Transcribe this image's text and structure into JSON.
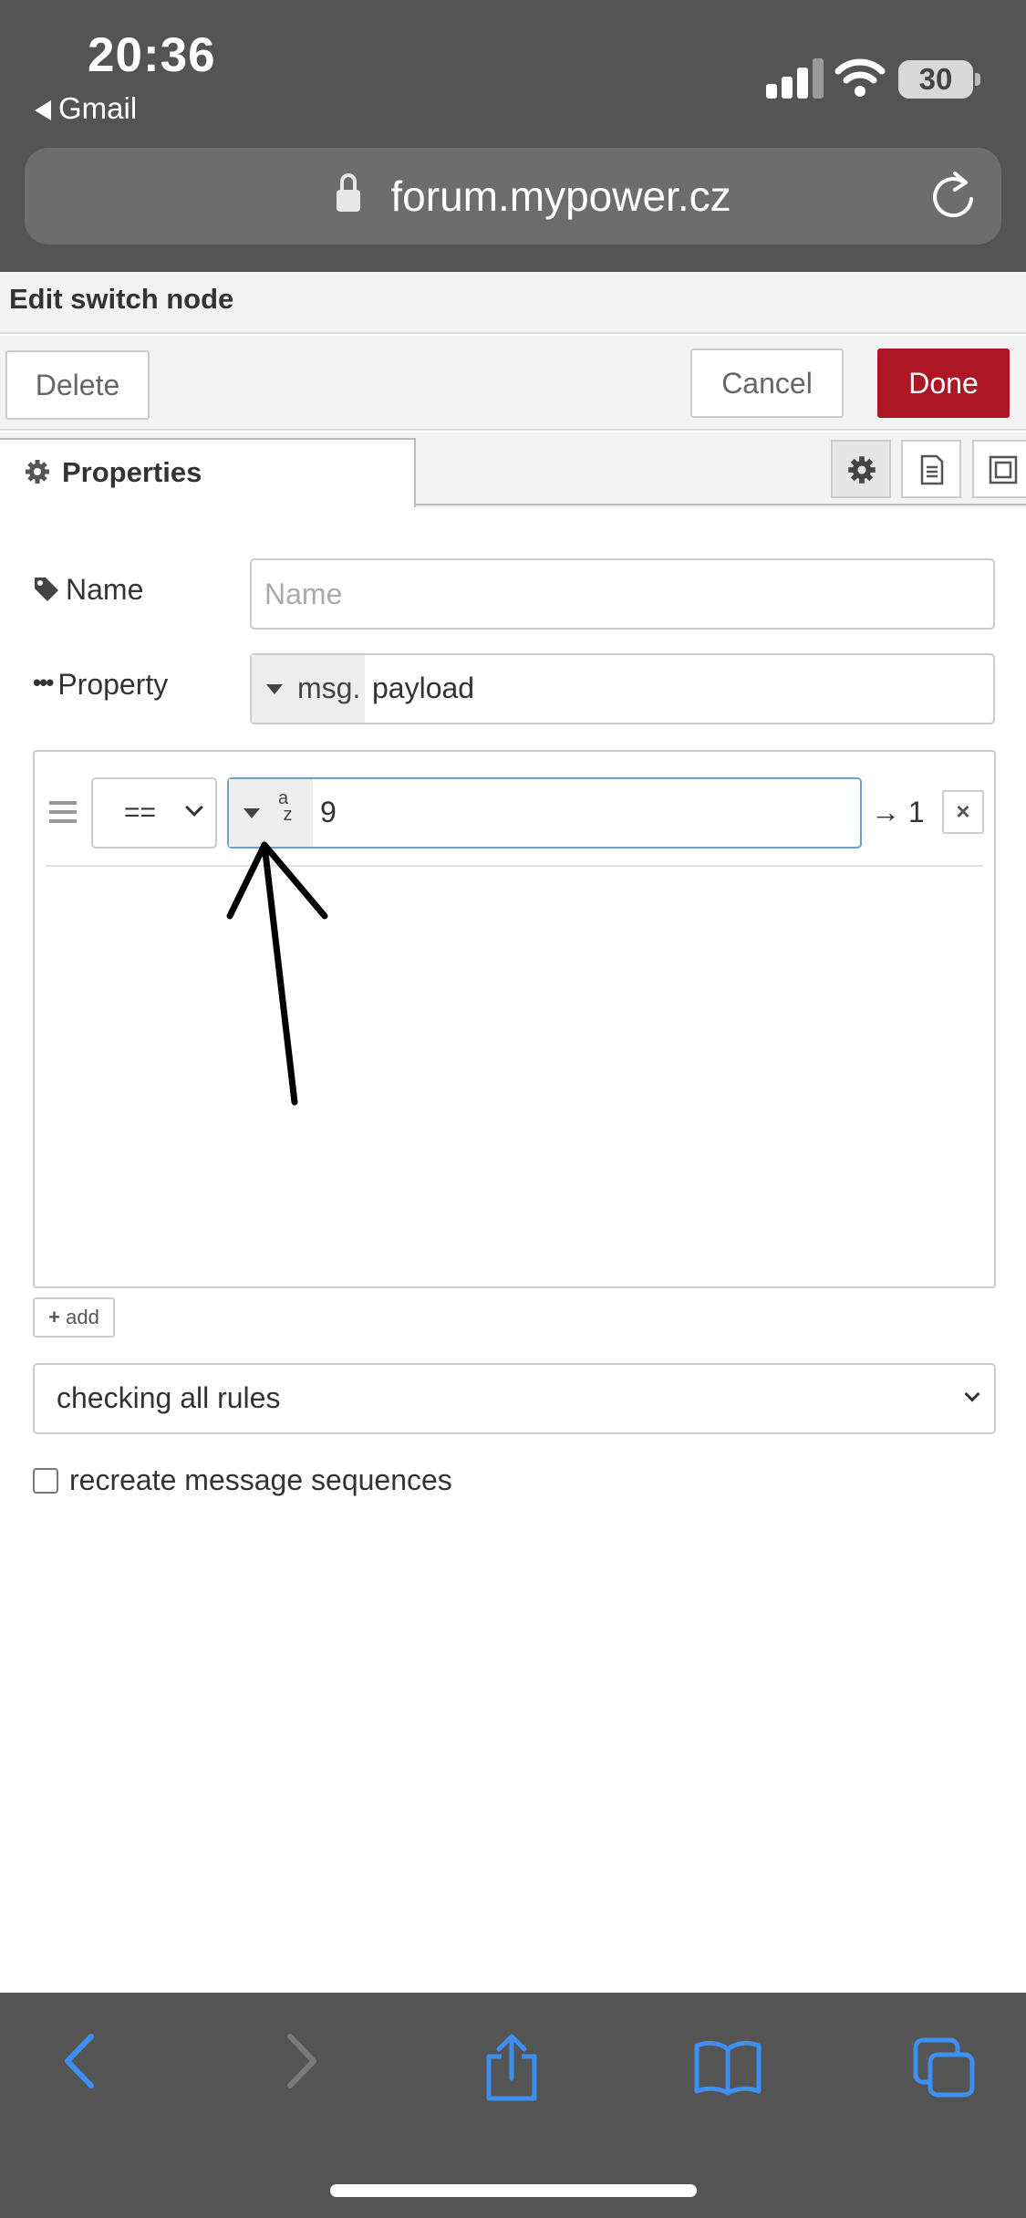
{
  "status": {
    "time": "20:36",
    "back_app": "Gmail",
    "battery": "30"
  },
  "browser": {
    "url": "forum.mypower.cz"
  },
  "editor": {
    "title": "Edit switch node",
    "delete_label": "Delete",
    "cancel_label": "Cancel",
    "done_label": "Done",
    "tab_properties": "Properties",
    "accent_color": "#ad1625"
  },
  "form": {
    "name_label": "Name",
    "name_placeholder": "Name",
    "name_value": "",
    "property_label": "Property",
    "property_type": "msg.",
    "property_value": "payload"
  },
  "rules": [
    {
      "operator": "==",
      "value_type_icon": "a-z-string-icon",
      "value": "9",
      "output": "→ 1"
    }
  ],
  "add_label": "add",
  "checking_mode": "checking all rules",
  "recreate_label": "recreate message sequences"
}
